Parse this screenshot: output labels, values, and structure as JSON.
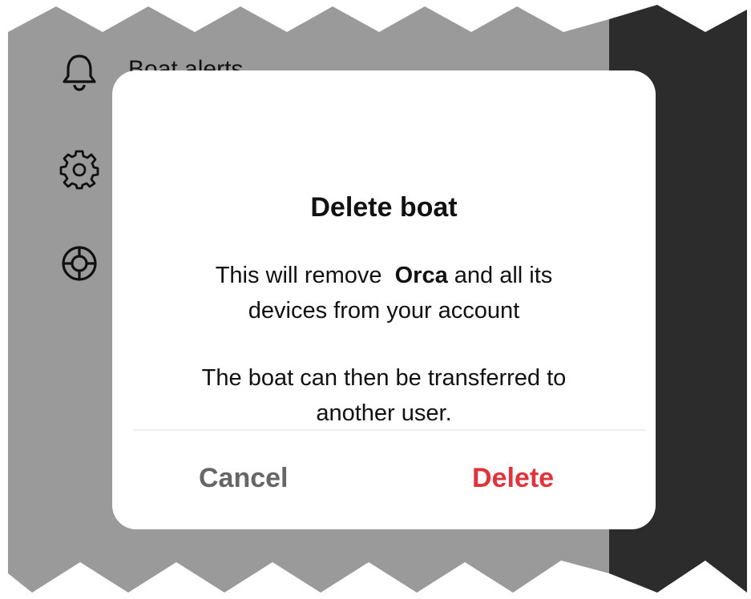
{
  "colors": {
    "backdrop_light": "#9a9a9a",
    "backdrop_dark": "#2c2c2c",
    "dialog_bg": "#ffffff",
    "cancel_text": "#666666",
    "delete_text": "#e0343c"
  },
  "menu": {
    "items": [
      {
        "label": "Boat alerts",
        "icon": "bell-icon"
      },
      {
        "label": "",
        "icon": "gear-icon"
      },
      {
        "label": "",
        "icon": "lifebuoy-icon"
      }
    ]
  },
  "dialog": {
    "title": "Delete boat",
    "message_pre": "This will remove ",
    "boat_name": "Orca",
    "message_post": " and all its",
    "message_line2": "devices from your account",
    "note_line1": "The boat can then be transferred to",
    "note_line2": "another user.",
    "cancel_label": "Cancel",
    "delete_label": "Delete"
  }
}
